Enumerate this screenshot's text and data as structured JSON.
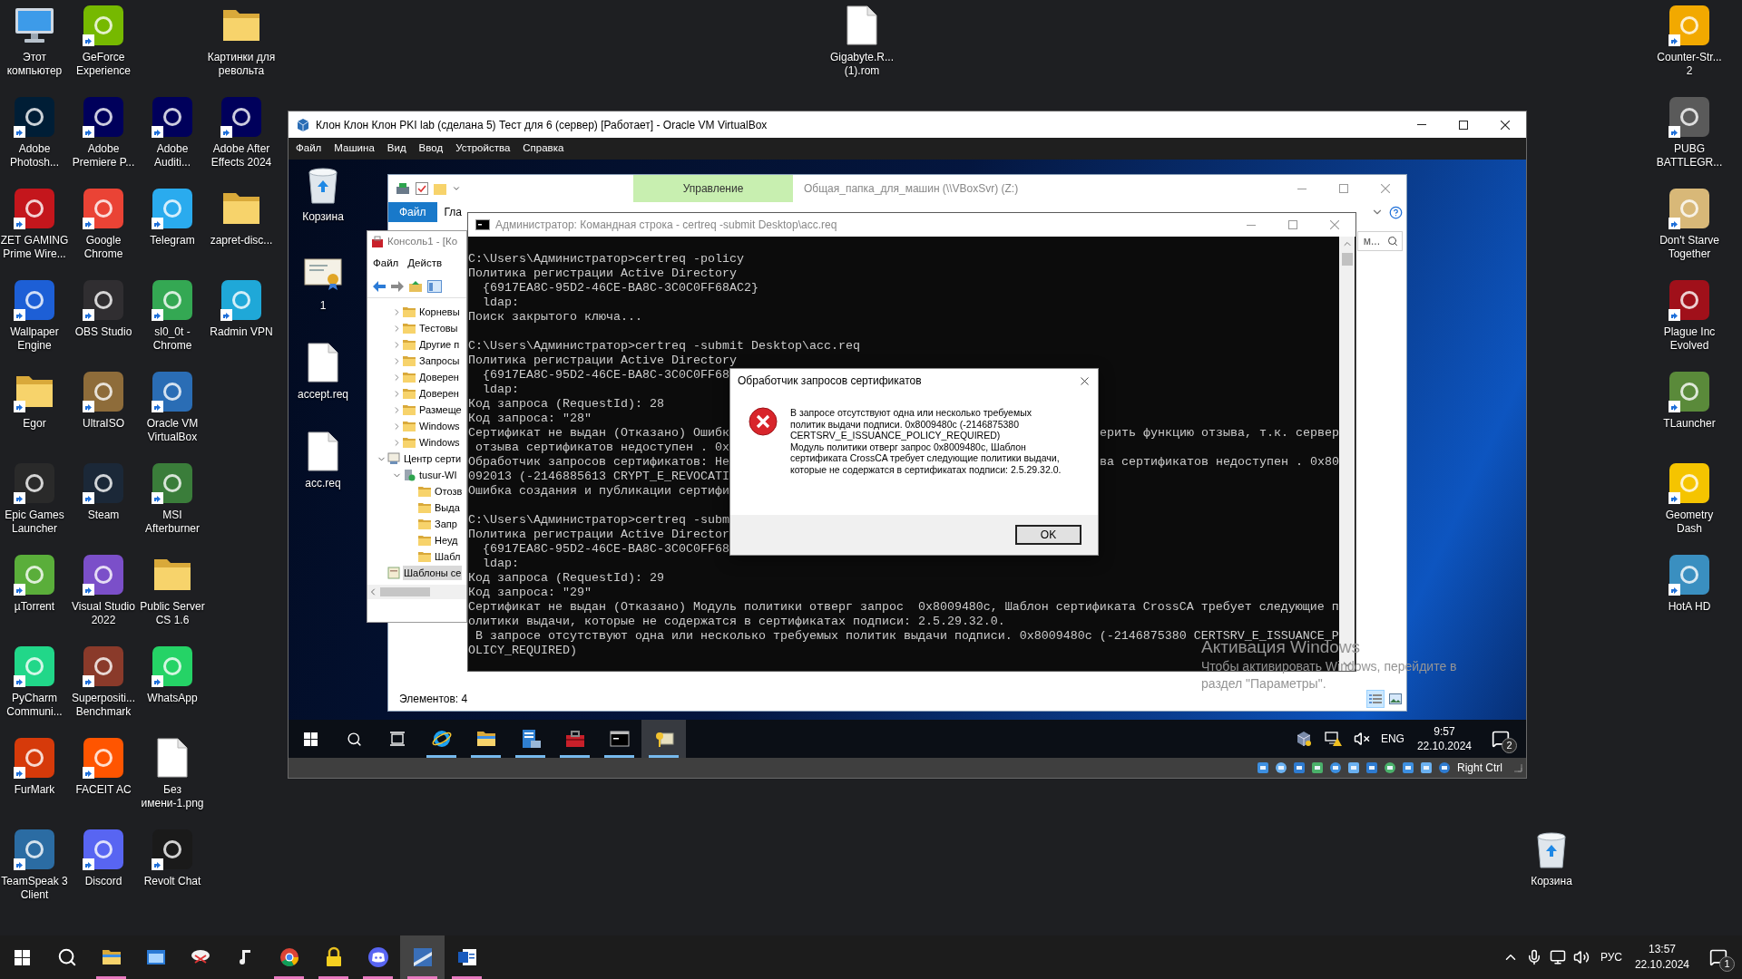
{
  "desktop": {
    "left_rows": [
      [
        {
          "label": "Этот компьютер",
          "kind": "computer",
          "shortcut": false
        },
        {
          "label": "GeForce Experience",
          "kind": "app",
          "color": "#76b900",
          "shortcut": true
        },
        null,
        {
          "label": "Картинки для револьта",
          "kind": "folder",
          "shortcut": false
        }
      ],
      [
        {
          "label": "Adobe Photosh...",
          "kind": "app",
          "color": "#001e36",
          "shortcut": true
        },
        {
          "label": "Adobe Premiere P...",
          "kind": "app",
          "color": "#00005b",
          "shortcut": true
        },
        {
          "label": "Adobe Auditi...",
          "kind": "app",
          "color": "#00005b",
          "shortcut": true
        },
        {
          "label": "Adobe After Effects 2024",
          "kind": "app",
          "color": "#00005b",
          "shortcut": true
        }
      ],
      [
        {
          "label": "ZET GAMING Prime Wire...",
          "kind": "app",
          "color": "#c4161c",
          "shortcut": true
        },
        {
          "label": "Google Chrome",
          "kind": "app",
          "color": "#ea4335",
          "shortcut": true
        },
        {
          "label": "Telegram",
          "kind": "app",
          "color": "#2aabee",
          "shortcut": true
        },
        {
          "label": "zapret-disc...",
          "kind": "folder",
          "shortcut": false
        }
      ],
      [
        {
          "label": "Wallpaper Engine",
          "kind": "app",
          "color": "#1d5fd6",
          "shortcut": true
        },
        {
          "label": "OBS Studio",
          "kind": "app",
          "color": "#302e31",
          "shortcut": true
        },
        {
          "label": "sl0_0t - Chrome",
          "kind": "app",
          "color": "#34a853",
          "shortcut": true
        },
        {
          "label": "Radmin VPN",
          "kind": "app",
          "color": "#1fa8d8",
          "shortcut": true
        }
      ],
      [
        {
          "label": "Egor",
          "kind": "folder",
          "shortcut": true
        },
        {
          "label": "UltraISO",
          "kind": "app",
          "color": "#8e6c3a",
          "shortcut": true
        },
        {
          "label": "Oracle VM VirtualBox",
          "kind": "app",
          "color": "#2a6db5",
          "shortcut": true
        }
      ],
      [
        {
          "label": "Epic Games Launcher",
          "kind": "app",
          "color": "#2a2a2a",
          "shortcut": true
        },
        {
          "label": "Steam",
          "kind": "app",
          "color": "#1b2838",
          "shortcut": true
        },
        {
          "label": "MSI Afterburner",
          "kind": "app",
          "color": "#3a7d3a",
          "shortcut": true
        }
      ],
      [
        {
          "label": "µTorrent",
          "kind": "app",
          "color": "#5aae3a",
          "shortcut": true
        },
        {
          "label": "Visual Studio 2022",
          "kind": "app",
          "color": "#7b4fc9",
          "shortcut": true
        },
        {
          "label": "Public Server CS 1.6",
          "kind": "folder",
          "shortcut": false
        }
      ],
      [
        {
          "label": "PyCharm Communi...",
          "kind": "app",
          "color": "#21d789",
          "shortcut": true
        },
        {
          "label": "Superpositi... Benchmark",
          "kind": "app",
          "color": "#8a3a2a",
          "shortcut": true
        },
        {
          "label": "WhatsApp",
          "kind": "app",
          "color": "#25d366",
          "shortcut": true
        }
      ],
      [
        {
          "label": "FurMark",
          "kind": "app",
          "color": "#d63a0a",
          "shortcut": true
        },
        {
          "label": "FACEIT AC",
          "kind": "app",
          "color": "#ff5500",
          "shortcut": true
        },
        {
          "label": "Без имени-1.png",
          "kind": "file",
          "shortcut": false
        }
      ],
      [
        {
          "label": "TeamSpeak 3 Client",
          "kind": "app",
          "color": "#2b6ca3",
          "shortcut": true
        },
        {
          "label": "Discord",
          "kind": "app",
          "color": "#5865f2",
          "shortcut": true
        },
        {
          "label": "Revolt Chat",
          "kind": "app",
          "color": "#1a1a1a",
          "shortcut": true
        }
      ]
    ],
    "top_file": {
      "label": "Gigabyte.R... (1).rom",
      "kind": "file",
      "shortcut": false
    },
    "right_column": [
      {
        "label": "Counter-Str... 2",
        "kind": "app",
        "color": "#f2a900",
        "shortcut": true
      },
      {
        "label": "PUBG BATTLEGR...",
        "kind": "app",
        "color": "#5a5a5a",
        "shortcut": true
      },
      {
        "label": "Don't Starve Together",
        "kind": "app",
        "color": "#d8b878",
        "shortcut": true
      },
      {
        "label": "Plague Inc Evolved",
        "kind": "app",
        "color": "#a0101a",
        "shortcut": true
      },
      {
        "label": "TLauncher",
        "kind": "app",
        "color": "#5a8a3a",
        "shortcut": true
      },
      {
        "label": "Geometry Dash",
        "kind": "app",
        "color": "#f5c400",
        "shortcut": true
      },
      {
        "label": "HotA HD",
        "kind": "app",
        "color": "#3a8fc0",
        "shortcut": true
      }
    ],
    "recycle_bin": {
      "label": "Корзина",
      "kind": "bin",
      "shortcut": false
    }
  },
  "vbox": {
    "title": "Клон Клон Клон PKI lab (сделана 5) Тест для 6 (сервер) [Работает] - Oracle VM VirtualBox",
    "menu": [
      "Файл",
      "Машина",
      "Вид",
      "Ввод",
      "Устройства",
      "Справка"
    ],
    "guest": {
      "desktop_icons": [
        {
          "label": "Корзина",
          "kind": "bin",
          "shortcut": false
        },
        {
          "label": "1",
          "kind": "certificate",
          "shortcut": false
        },
        {
          "label": "accept.req",
          "kind": "file",
          "shortcut": false
        },
        {
          "label": "acc.req",
          "kind": "file",
          "shortcut": false
        }
      ],
      "explorer": {
        "context_tab": "Управление",
        "title": "Общая_папка_для_машин (\\\\VBoxSvr) (Z:)",
        "ribbon_tabs": [
          {
            "label": "Файл",
            "selected": true
          },
          {
            "label": "Гла",
            "selected": false
          }
        ],
        "search": {
          "value": "м..."
        },
        "status": "Элементов: 4",
        "view_buttons": [
          {
            "selected": true
          },
          {
            "selected": false
          }
        ]
      },
      "mmc": {
        "title": "Консоль1 - [Ко",
        "menu": [
          "Файл",
          "Действ"
        ],
        "scrolled_branch_items": [
          {
            "label": "Корневы",
            "kind": "folder",
            "expanded": false,
            "selected": false
          },
          {
            "label": "Тестовы",
            "kind": "folder",
            "expanded": false,
            "selected": false
          },
          {
            "label": "Другие п",
            "kind": "folder",
            "expanded": false,
            "selected": false
          },
          {
            "label": "Запросы",
            "kind": "folder",
            "expanded": false,
            "selected": false
          },
          {
            "label": "Доверен",
            "kind": "folder",
            "expanded": false,
            "selected": false
          },
          {
            "label": "Доверен",
            "kind": "folder",
            "expanded": false,
            "selected": false
          },
          {
            "label": "Размеще",
            "kind": "folder",
            "expanded": false,
            "selected": false
          },
          {
            "label": "Windows",
            "kind": "folder",
            "expanded": false,
            "selected": false
          },
          {
            "label": "Windows",
            "kind": "folder",
            "expanded": false,
            "selected": false
          }
        ],
        "nodes": [
          {
            "label": "Центр серти",
            "kind": "authority",
            "expanded": true,
            "selected": false,
            "children": [
              {
                "label": "tusur-WI",
                "kind": "server",
                "expanded": true,
                "selected": false,
                "children": [
                  {
                    "label": "Отозв",
                    "kind": "folder",
                    "selected": false
                  },
                  {
                    "label": "Выда",
                    "kind": "folder",
                    "selected": false
                  },
                  {
                    "label": "Запр",
                    "kind": "folder",
                    "selected": false
                  },
                  {
                    "label": "Неуд",
                    "kind": "folder",
                    "selected": false
                  },
                  {
                    "label": "Шабл",
                    "kind": "folder",
                    "selected": false
                  }
                ]
              }
            ]
          },
          {
            "label": "Шаблоны се",
            "kind": "templates",
            "selected": true
          }
        ]
      },
      "cmd": {
        "title": "Администратор: Командная строка - certreq  -submit Desktop\\acc.req",
        "lines": [
          {
            "kind": "text",
            "text": "C:\\Users\\Администратор>certreq -policy"
          },
          {
            "kind": "text",
            "text": "Политика регистрации Active Directory"
          },
          {
            "kind": "text",
            "text": "  {6917EA8C-95D2-46CE-BA8C-3C0C0FF68AC2}"
          },
          {
            "kind": "text",
            "text": "  ldap:"
          },
          {
            "kind": "text",
            "text": "Поиск закрытого ключа..."
          },
          {
            "kind": "blank"
          },
          {
            "kind": "text",
            "text": "C:\\Users\\Администратор>certreq -submit Desktop\\acc.req"
          },
          {
            "kind": "text",
            "text": "Политика регистрации Active Directory"
          },
          {
            "kind": "text",
            "text": "  {6917EA8C-95D2-46CE-BA8C-3C0C0FF68"
          },
          {
            "kind": "text",
            "text": "  ldap:"
          },
          {
            "kind": "text",
            "text": "Код запроса (RequestId): 28"
          },
          {
            "kind": "text",
            "text": "Код запроса: \"28\""
          },
          {
            "kind": "text",
            "text": "Сертификат не выдан (Отказано) Ошибк",
            "right": "ерить функцию отзыва, т.к. сервер"
          },
          {
            "kind": "text",
            "text": " отзыва сертификатов недоступен . 0x"
          },
          {
            "kind": "text",
            "text": "Обработчик запросов сертификатов: Не",
            "right": "ва сертификатов недоступен . 0x80"
          },
          {
            "kind": "text",
            "text": "092013 (-2146885613 CRYPT_E_REVOCATI"
          },
          {
            "kind": "text",
            "text": "Ошибка создания и публикации сертифи"
          },
          {
            "kind": "blank"
          },
          {
            "kind": "text",
            "text": "C:\\Users\\Администратор>certreq -subm"
          },
          {
            "kind": "text",
            "text": "Политика регистрации Active Director"
          },
          {
            "kind": "text",
            "text": "  {6917EA8C-95D2-46CE-BA8C-3C0C0FF68"
          },
          {
            "kind": "text",
            "text": "  ldap:"
          },
          {
            "kind": "text",
            "text": "Код запроса (RequestId): 29"
          },
          {
            "kind": "text",
            "text": "Код запроса: \"29\""
          },
          {
            "kind": "text",
            "text": "Сертификат не выдан (Отказано) Модуль политики отверг запрос  0x8009480c, Шаблон сертификата CrossCA требует следующие п"
          },
          {
            "kind": "text",
            "text": "олитики выдачи, которые не содержатся в сертификатах подписи: 2.5.29.32.0."
          },
          {
            "kind": "text",
            "text": " В запросе отсутствуют одна или несколько требуемых политик выдачи подписи. 0x8009480c (-2146875380 CERTSRV_E_ISSUANCE_P"
          },
          {
            "kind": "text",
            "text": "OLICY_REQUIRED)"
          }
        ]
      },
      "dialog": {
        "title": "Обработчик запросов сертификатов",
        "message": [
          "В запросе отсутствуют одна или несколько требуемых политик выдачи подписи. 0x8009480c (-2146875380 CERTSRV_E_ISSUANCE_POLICY_REQUIRED)",
          "Модуль политики отверг запрос  0x8009480c, Шаблон сертификата CrossCA требует следующие политики выдачи, которые не содержатся в сертификатах подписи: 2.5.29.32.0."
        ],
        "button": "OK"
      },
      "activation": {
        "title": "Активация Windows",
        "text": "Чтобы активировать Windows, перейдите в раздел \"Параметры\"."
      },
      "taskbar": {
        "apps": [
          {
            "kind": "ie",
            "running": true,
            "selected": false
          },
          {
            "kind": "explorer",
            "running": true,
            "selected": false
          },
          {
            "kind": "server",
            "running": true,
            "selected": false
          },
          {
            "kind": "toolbox",
            "running": true,
            "selected": false
          },
          {
            "kind": "cmd",
            "running": true,
            "selected": false
          },
          {
            "kind": "cert",
            "running": true,
            "selected": true
          }
        ],
        "tray": {
          "language": "ENG",
          "time": "9:57",
          "date": "22.10.2024",
          "notifications": "2"
        }
      }
    },
    "status_bar": {
      "host_key": "Right Ctrl"
    }
  },
  "taskbar": {
    "apps": [
      {
        "kind": "explorer",
        "running": true,
        "selected": false
      },
      {
        "kind": "control",
        "running": false,
        "selected": false
      },
      {
        "kind": "snip",
        "running": false,
        "selected": false
      },
      {
        "kind": "music",
        "running": false,
        "selected": false
      },
      {
        "kind": "chrome",
        "running": true,
        "selected": false
      },
      {
        "kind": "lock",
        "running": true,
        "selected": false
      },
      {
        "kind": "discord",
        "running": true,
        "selected": false
      },
      {
        "kind": "cs",
        "running": true,
        "selected": true
      },
      {
        "kind": "word",
        "running": true,
        "selected": false
      }
    ],
    "tray": {
      "language": "РУС",
      "time": "13:57",
      "date": "22.10.2024",
      "notifications": "1"
    }
  }
}
